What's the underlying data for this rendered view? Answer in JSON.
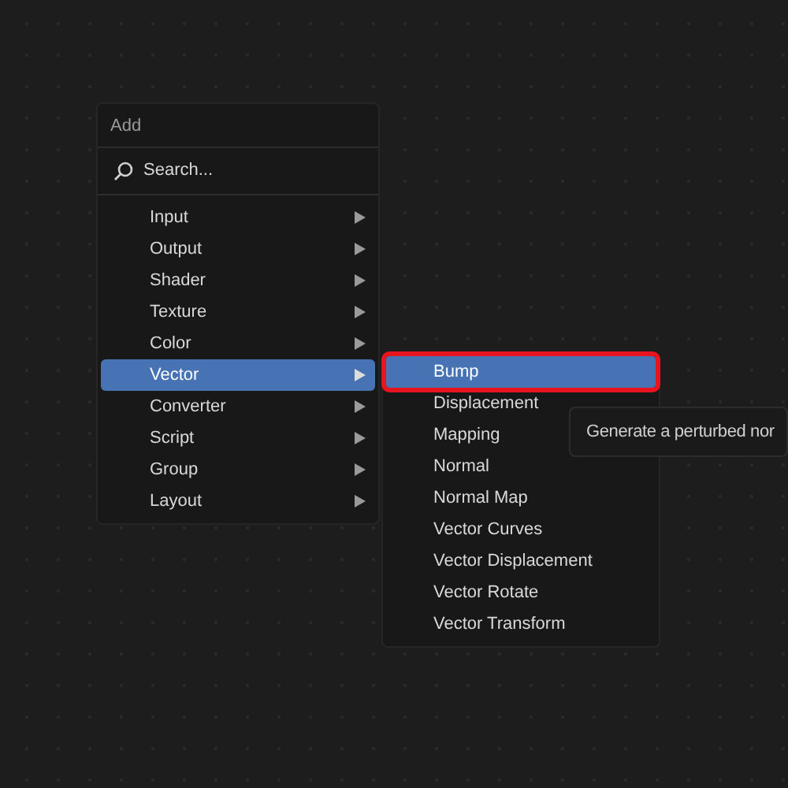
{
  "menu": {
    "title": "Add",
    "search": {
      "placeholder": "Search..."
    },
    "items": [
      {
        "label": "Input",
        "selected": false
      },
      {
        "label": "Output",
        "selected": false
      },
      {
        "label": "Shader",
        "selected": false
      },
      {
        "label": "Texture",
        "selected": false
      },
      {
        "label": "Color",
        "selected": false
      },
      {
        "label": "Vector",
        "selected": true
      },
      {
        "label": "Converter",
        "selected": false
      },
      {
        "label": "Script",
        "selected": false
      },
      {
        "label": "Group",
        "selected": false
      },
      {
        "label": "Layout",
        "selected": false
      }
    ]
  },
  "submenu": {
    "items": [
      {
        "label": "Bump",
        "selected": true,
        "outlined": true
      },
      {
        "label": "Displacement",
        "selected": false,
        "outlined": false
      },
      {
        "label": "Mapping",
        "selected": false,
        "outlined": false
      },
      {
        "label": "Normal",
        "selected": false,
        "outlined": false
      },
      {
        "label": "Normal Map",
        "selected": false,
        "outlined": false
      },
      {
        "label": "Vector Curves",
        "selected": false,
        "outlined": false
      },
      {
        "label": "Vector Displacement",
        "selected": false,
        "outlined": false
      },
      {
        "label": "Vector Rotate",
        "selected": false,
        "outlined": false
      },
      {
        "label": "Vector Transform",
        "selected": false,
        "outlined": false
      }
    ]
  },
  "tooltip": {
    "text": "Generate a perturbed nor"
  }
}
